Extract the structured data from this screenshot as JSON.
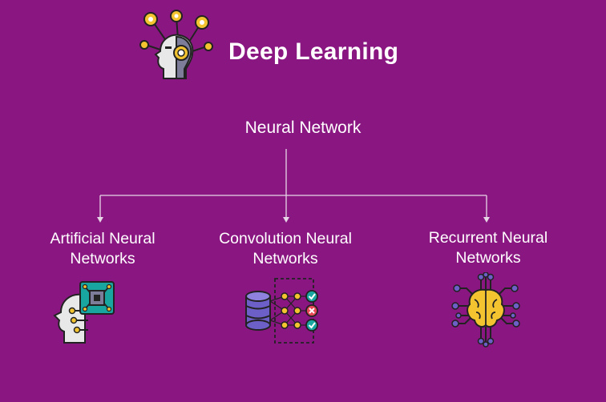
{
  "header": {
    "title": "Deep Learning",
    "logo_icon": "ai-head-network-icon"
  },
  "root_node": {
    "label": "Neural Network"
  },
  "branches": [
    {
      "line1": "Artificial Neural",
      "line2": "Networks",
      "icon": "ai-head-chip-icon"
    },
    {
      "line1": "Convolution Neural",
      "line2": "Networks",
      "icon": "database-network-icon"
    },
    {
      "line1": "Recurrent Neural",
      "line2": "Networks",
      "icon": "brain-circuit-icon"
    }
  ],
  "colors": {
    "background": "#8a1781",
    "text": "#ffffff",
    "connector": "#e6d6e6",
    "accent_yellow": "#f4c430",
    "accent_teal": "#1aa6a0",
    "accent_purple": "#6c5fc7"
  }
}
